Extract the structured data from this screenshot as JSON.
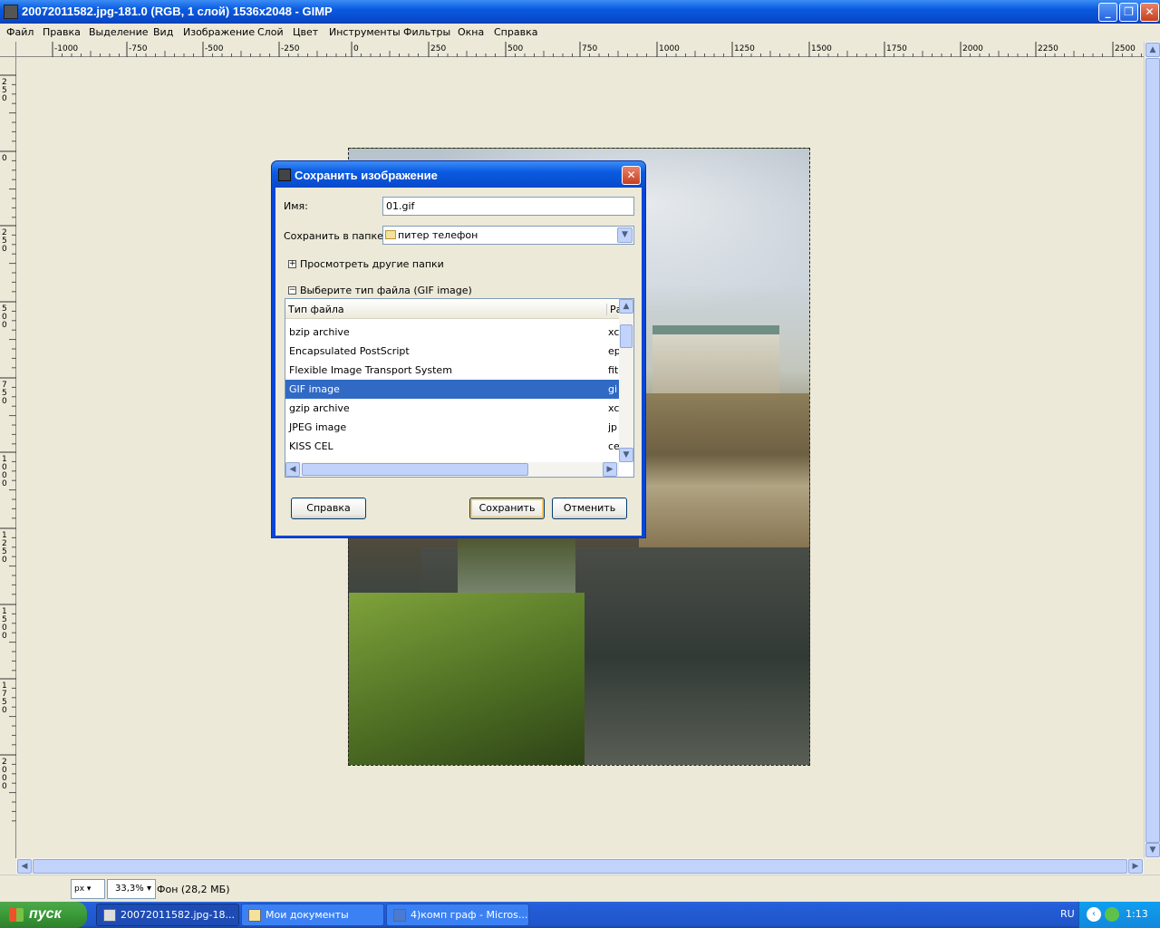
{
  "window": {
    "title": "20072011582.jpg-181.0 (RGB, 1 слой) 1536x2048 - GIMP"
  },
  "menu": [
    "Файл",
    "Правка",
    "Выделение",
    "Вид",
    "Изображение",
    "Слой",
    "Цвет",
    "Инструменты",
    "Фильтры",
    "Окна",
    "Справка"
  ],
  "ruler": {
    "h_ticks": [
      "-1000",
      "-750",
      "-500",
      "-250",
      "0",
      "250",
      "500",
      "750",
      "1000",
      "1250",
      "1500",
      "1750",
      "2000",
      "2250",
      "2500"
    ],
    "v_ticks": [
      "250",
      "0",
      "250",
      "500",
      "750",
      "1000",
      "1250",
      "1500",
      "1750",
      "2000"
    ]
  },
  "status": {
    "unit": "px",
    "zoom": "33,3%",
    "layer_info": "Фон (28,2 МБ)"
  },
  "dialog": {
    "title": "Сохранить изображение",
    "name_label": "Имя:",
    "name_value": "01.gif",
    "folder_label": "Сохранить в папке",
    "folder_value": "питер телефон",
    "browse_label": "Просмотреть другие папки",
    "filetype_label": "Выберите тип файла (GIF image)",
    "columns": {
      "type": "Тип файла",
      "ext": "Ра"
    },
    "rows": [
      {
        "name": "bzip archive",
        "ext": "xc"
      },
      {
        "name": "Encapsulated PostScript",
        "ext": "ep"
      },
      {
        "name": "Flexible Image Transport System",
        "ext": "fit"
      },
      {
        "name": "GIF image",
        "ext": "gi"
      },
      {
        "name": "gzip archive",
        "ext": "xc"
      },
      {
        "name": "JPEG image",
        "ext": "jp"
      },
      {
        "name": "KISS CEL",
        "ext": "ce"
      }
    ],
    "selected_row": "GIF image",
    "help_button": "Справка",
    "save_button": "Сохранить",
    "cancel_button": "Отменить"
  },
  "taskbar": {
    "start_label": "пуск",
    "tasks": [
      {
        "label": "20072011582.jpg-18..."
      },
      {
        "label": "Мои документы"
      },
      {
        "label": "4)комп граф - Micros..."
      }
    ],
    "lang": "RU",
    "clock": "1:13"
  }
}
